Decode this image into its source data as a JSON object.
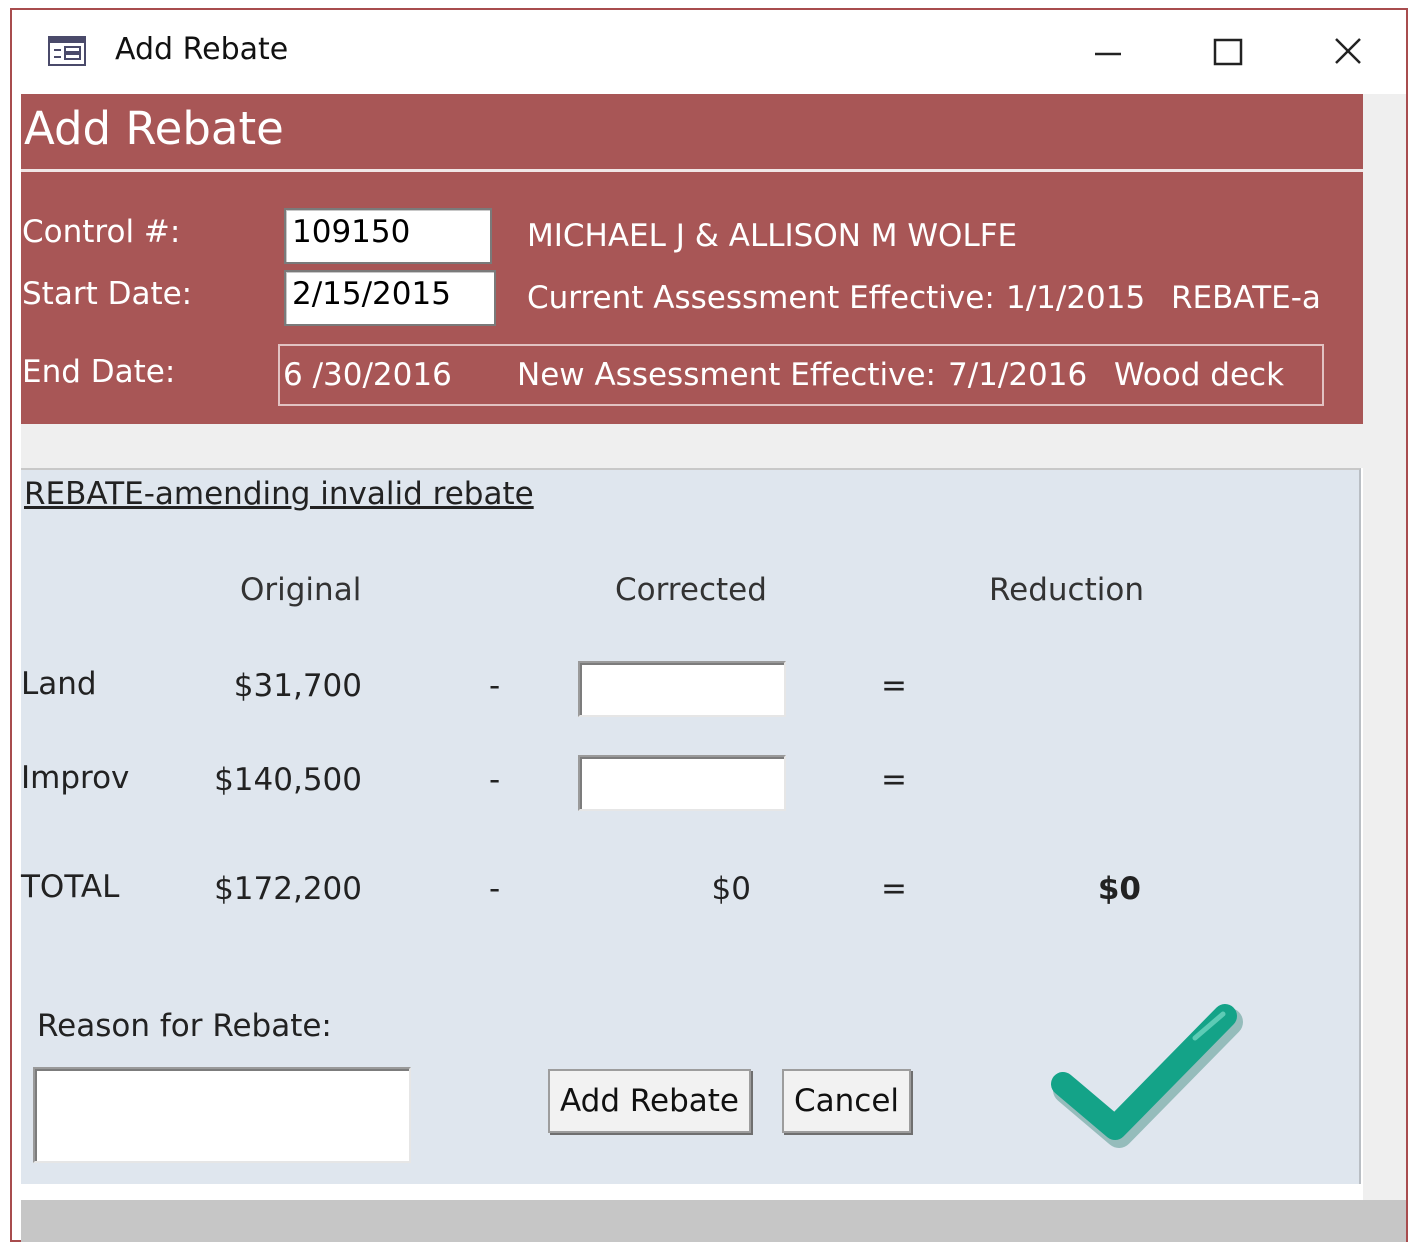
{
  "window": {
    "title": "Add Rebate",
    "icon": "form-icon",
    "controls": [
      "minimize-icon",
      "maximize-icon",
      "close-icon"
    ]
  },
  "header": {
    "title": "Add Rebate",
    "control_label": "Control #:",
    "control_value": "109150",
    "owner_name": "MICHAEL J & ALLISON M WOLFE",
    "start_label": "Start Date:",
    "start_value": "2/15/2015",
    "current_assessment_label": "Current Assessment Effective:",
    "current_assessment_date": "1/1/2015",
    "current_assessment_note": "REBATE-a",
    "end_label": "End Date:",
    "end_value": "6 /30/2016",
    "new_assessment_label": "New Assessment Effective:",
    "new_assessment_date": "7/1/2016",
    "new_assessment_note": "Wood deck"
  },
  "detail": {
    "section_title": "REBATE-amending invalid rebate",
    "columns": {
      "original": "Original",
      "corrected": "Corrected",
      "reduction": "Reduction"
    },
    "rows": [
      {
        "label": "Land",
        "original": "$31,700",
        "minus": "-",
        "corrected": "",
        "equals": "=",
        "reduction": ""
      },
      {
        "label": "Improv",
        "original": "$140,500",
        "minus": "-",
        "corrected": "",
        "equals": "=",
        "reduction": ""
      },
      {
        "label": "TOTAL",
        "original": "$172,200",
        "minus": "-",
        "corrected": "$0",
        "equals": "=",
        "reduction": "$0"
      }
    ],
    "reason_label": "Reason for Rebate:",
    "reason_value": "",
    "add_button": "Add Rebate",
    "cancel_button": "Cancel",
    "status_icon": "checkmark-icon"
  },
  "colors": {
    "header_band": "#a85656",
    "detail_panel": "#dfe6ee",
    "checkmark": "#14a388",
    "window_border": "#a84c4e"
  }
}
